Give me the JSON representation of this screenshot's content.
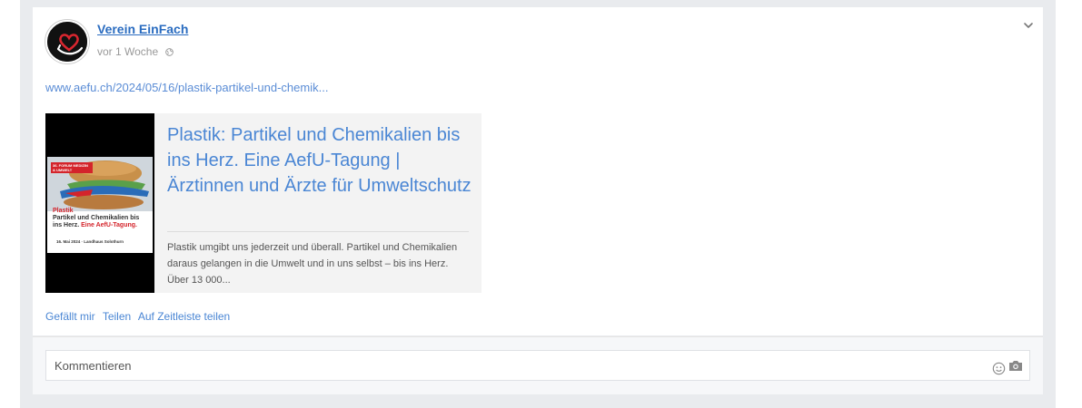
{
  "post": {
    "author": "Verein EinFach",
    "timestamp": "vor 1 Woche",
    "visibility_icon": "globe-icon",
    "url": "www.aefu.ch/2024/05/16/plastik-partikel-und-chemik...",
    "link_preview": {
      "title": "Plastik: Partikel und Chemikalien bis ins Herz. Eine AefU-Tagung | Ärztinnen und Ärzte für Umweltschutz",
      "description": "Plastik umgibt uns jederzeit und überall. Partikel und Chemikalien daraus gelangen in die Umwelt und in uns selbst – bis ins Herz. Über 13 000...",
      "poster": {
        "tag": "36. FORUM MEDIZIN & UMWELT",
        "title_line1": "Plastik",
        "title_line2": "Partikel und Chemikalien bis",
        "title_line3": "ins Herz.",
        "title_highlight": "Eine AefU-Tagung.",
        "date": "16. Mai 2024 · Landhaus Solothurn"
      }
    },
    "actions": {
      "like": "Gefällt mir",
      "share": "Teilen",
      "share_timeline": "Auf Zeitleiste teilen"
    }
  },
  "comment": {
    "placeholder": "Kommentieren",
    "emoji_icon": "smiley-icon",
    "photo_icon": "camera-icon"
  },
  "colors": {
    "link": "#4a86d4",
    "author": "#2a6cc0",
    "background": "#e9ebee"
  }
}
